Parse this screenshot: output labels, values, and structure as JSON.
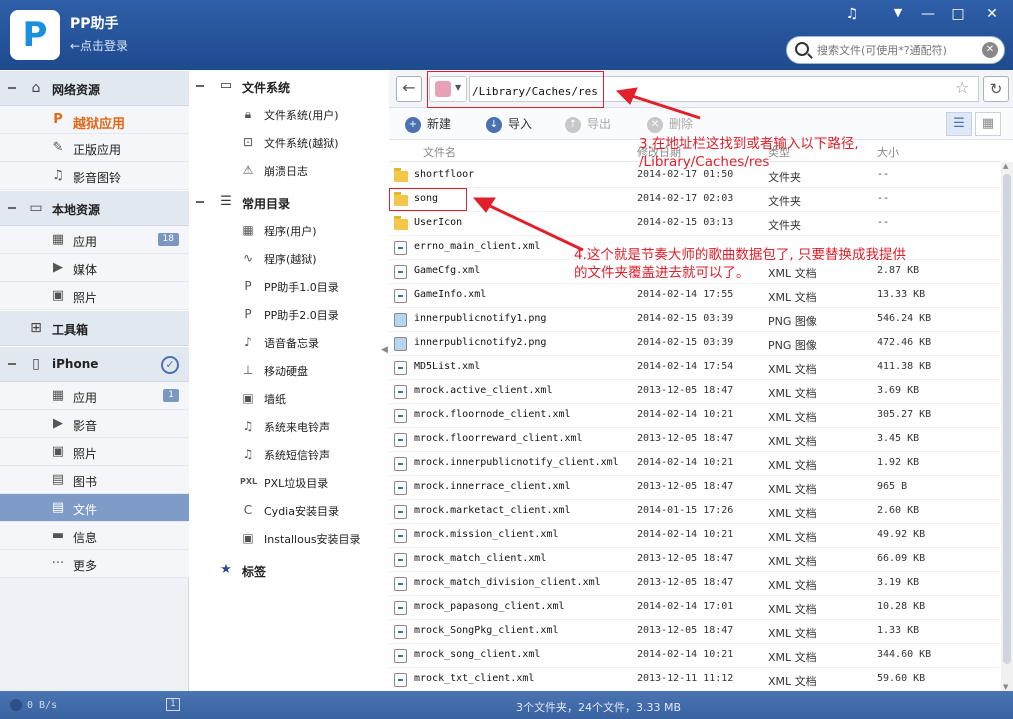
{
  "app": {
    "name": "PP助手",
    "login": "←点击登录",
    "logo": "P"
  },
  "window_controls": {
    "music_icon": "♫",
    "menu_icon": "▼",
    "min_icon": "—",
    "max_icon": "□",
    "close_icon": "✕"
  },
  "search": {
    "placeholder": "搜索文件(可使用*?通配符)"
  },
  "sidebar": {
    "sections": [
      {
        "label": "网络资源",
        "icon": "home-icon",
        "items": [
          {
            "label": "越狱应用",
            "icon": "pp-icon",
            "style": "orange"
          },
          {
            "label": "正版应用",
            "icon": "appstore-icon"
          },
          {
            "label": "影音图铃",
            "icon": "music-icon"
          }
        ]
      },
      {
        "label": "本地资源",
        "icon": "monitor-icon",
        "items": [
          {
            "label": "应用",
            "icon": "grid-icon",
            "count": "18"
          },
          {
            "label": "媒体",
            "icon": "video-icon"
          },
          {
            "label": "照片",
            "icon": "photo-icon"
          }
        ]
      },
      {
        "label": "工具箱",
        "icon": "toolbox-icon",
        "items": []
      },
      {
        "label": "iPhone",
        "icon": "phone-icon",
        "items": [
          {
            "label": "应用",
            "icon": "grid-icon",
            "count": "1"
          },
          {
            "label": "影音",
            "icon": "video-icon"
          },
          {
            "label": "照片",
            "icon": "photo-icon"
          },
          {
            "label": "图书",
            "icon": "book-icon"
          },
          {
            "label": "文件",
            "icon": "file-icon",
            "active": true
          },
          {
            "label": "信息",
            "icon": "message-icon"
          },
          {
            "label": "更多",
            "icon": "more-icon"
          }
        ]
      }
    ]
  },
  "tree": {
    "filesystem": {
      "label": "文件系统",
      "items": [
        "文件系统(用户)",
        "文件系统(越狱)",
        "崩溃日志"
      ]
    },
    "common": {
      "label": "常用目录",
      "items": [
        "程序(用户)",
        "程序(越狱)",
        "PP助手1.0目录",
        "PP助手2.0目录",
        "语音备忘录",
        "移动硬盘",
        "墙纸",
        "系统来电铃声",
        "系统短信铃声",
        "PXL垃圾目录",
        "Cydia安装目录",
        "Installous安装目录"
      ]
    },
    "bookmarks": {
      "label": "标签"
    }
  },
  "address": {
    "path": "/Library/Caches/res"
  },
  "toolbar": {
    "new": "新建",
    "import": "导入",
    "export": "导出",
    "delete": "删除"
  },
  "columns": {
    "name": "文件名",
    "date": "修改日期",
    "type": "类型",
    "size": "大小"
  },
  "files": [
    {
      "name": "shortfloor",
      "date": "2014-02-17 01:50",
      "type": "文件夹",
      "size": "--",
      "kind": "folder"
    },
    {
      "name": "song",
      "date": "2014-02-17 02:03",
      "type": "文件夹",
      "size": "--",
      "kind": "folder"
    },
    {
      "name": "UserIcon",
      "date": "2014-02-15 03:13",
      "type": "文件夹",
      "size": "--",
      "kind": "folder"
    },
    {
      "name": "errno_main_client.xml",
      "date": "",
      "type": "",
      "size": "",
      "kind": "xml"
    },
    {
      "name": "GameCfg.xml",
      "date": "",
      "type": "XML 文档",
      "size": "2.87 KB",
      "kind": "xml"
    },
    {
      "name": "GameInfo.xml",
      "date": "2014-02-14 17:55",
      "type": "XML 文档",
      "size": "13.33 KB",
      "kind": "xml"
    },
    {
      "name": "innerpublicnotify1.png",
      "date": "2014-02-15 03:39",
      "type": "PNG 图像",
      "size": "546.24 KB",
      "kind": "png"
    },
    {
      "name": "innerpublicnotify2.png",
      "date": "2014-02-15 03:39",
      "type": "PNG 图像",
      "size": "472.46 KB",
      "kind": "png"
    },
    {
      "name": "MD5List.xml",
      "date": "2014-02-14 17:54",
      "type": "XML 文档",
      "size": "411.38 KB",
      "kind": "xml"
    },
    {
      "name": "mrock.active_client.xml",
      "date": "2013-12-05 18:47",
      "type": "XML 文档",
      "size": "3.69 KB",
      "kind": "xml"
    },
    {
      "name": "mrock.floornode_client.xml",
      "date": "2014-02-14 10:21",
      "type": "XML 文档",
      "size": "305.27 KB",
      "kind": "xml"
    },
    {
      "name": "mrock.floorreward_client.xml",
      "date": "2013-12-05 18:47",
      "type": "XML 文档",
      "size": "3.45 KB",
      "kind": "xml"
    },
    {
      "name": "mrock.innerpublicnotify_client.xml",
      "date": "2014-02-14 10:21",
      "type": "XML 文档",
      "size": "1.92 KB",
      "kind": "xml"
    },
    {
      "name": "mrock.innerrace_client.xml",
      "date": "2013-12-05 18:47",
      "type": "XML 文档",
      "size": "965 B",
      "kind": "xml"
    },
    {
      "name": "mrock.marketact_client.xml",
      "date": "2014-01-15 17:26",
      "type": "XML 文档",
      "size": "2.60 KB",
      "kind": "xml"
    },
    {
      "name": "mrock.mission_client.xml",
      "date": "2014-02-14 10:21",
      "type": "XML 文档",
      "size": "49.92 KB",
      "kind": "xml"
    },
    {
      "name": "mrock_match_client.xml",
      "date": "2013-12-05 18:47",
      "type": "XML 文档",
      "size": "66.09 KB",
      "kind": "xml"
    },
    {
      "name": "mrock_match_division_client.xml",
      "date": "2013-12-05 18:47",
      "type": "XML 文档",
      "size": "3.19 KB",
      "kind": "xml"
    },
    {
      "name": "mrock_papasong_client.xml",
      "date": "2014-02-14 17:01",
      "type": "XML 文档",
      "size": "10.28 KB",
      "kind": "xml"
    },
    {
      "name": "mrock_SongPkg_client.xml",
      "date": "2013-12-05 18:47",
      "type": "XML 文档",
      "size": "1.33 KB",
      "kind": "xml"
    },
    {
      "name": "mrock_song_client.xml",
      "date": "2014-02-14 10:21",
      "type": "XML 文档",
      "size": "344.60 KB",
      "kind": "xml"
    },
    {
      "name": "mrock_txt_client.xml",
      "date": "2013-12-11 11:12",
      "type": "XML 文档",
      "size": "59.60 KB",
      "kind": "xml"
    }
  ],
  "annotations": {
    "note3_line1": "3.在地址栏这找到或者输入以下路径,",
    "note3_line2": "/Library/Caches/res",
    "note4_line1": "4.这个就是节奏大师的歌曲数据包了, 只要替换成我提供",
    "note4_line2": "的文件夹覆盖进去就可以了。",
    "color": "#e0202a"
  },
  "status": {
    "speed": "0 B/s",
    "tasks": "1",
    "summary": "3个文件夹，24个文件，3.33 MB"
  }
}
